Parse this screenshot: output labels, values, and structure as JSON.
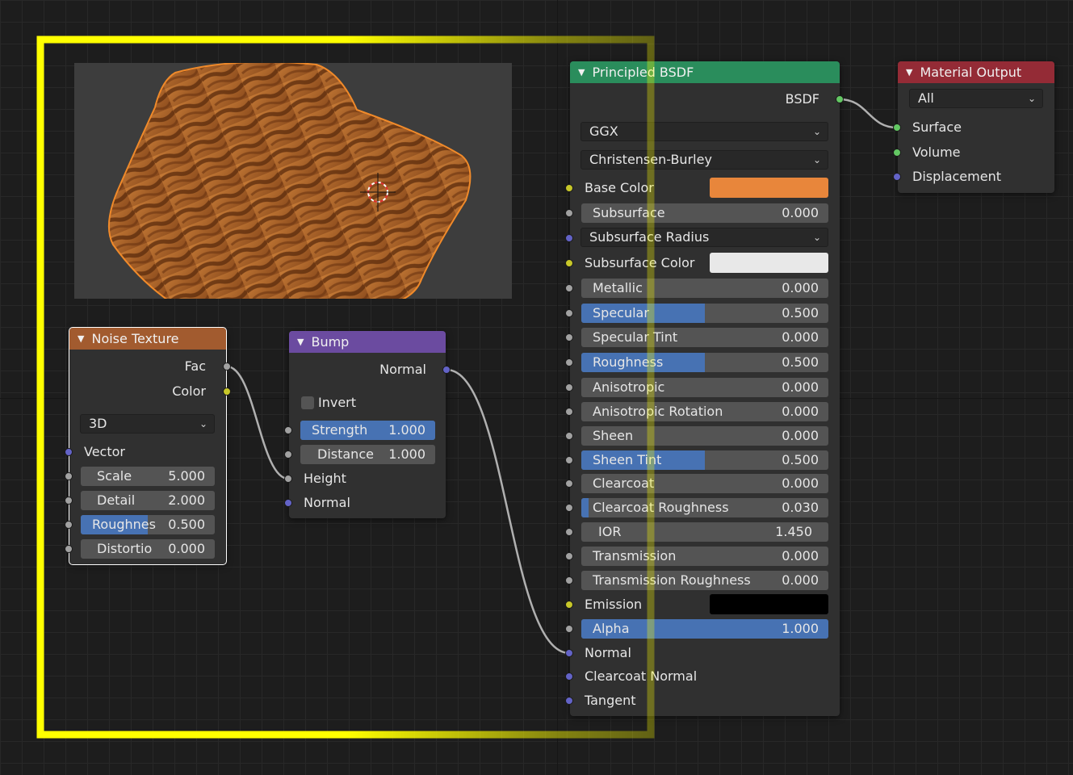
{
  "noise_texture": {
    "title": "Noise Texture",
    "outputs": [
      "Fac",
      "Color"
    ],
    "dimension": "3D",
    "vector_label": "Vector",
    "fields": [
      {
        "label": "Scale",
        "value": "5.000",
        "fill": 0
      },
      {
        "label": "Detail",
        "value": "2.000",
        "fill": 0
      },
      {
        "label": "Roughnes",
        "value": "0.500",
        "fill": 0.5
      },
      {
        "label": "Distortio",
        "value": "0.000",
        "fill": 0
      }
    ]
  },
  "bump": {
    "title": "Bump",
    "output": "Normal",
    "invert_label": "Invert",
    "invert_checked": false,
    "fields": [
      {
        "label": "Strength",
        "value": "1.000",
        "fill": 1
      },
      {
        "label": "Distance",
        "value": "1.000",
        "fill": 0
      }
    ],
    "inputs": [
      "Height",
      "Normal"
    ]
  },
  "principled_bsdf": {
    "title": "Principled BSDF",
    "output": "BSDF",
    "distribution": "GGX",
    "subsurface_method": "Christensen-Burley",
    "base_color_label": "Base Color",
    "base_color": "#e8863b",
    "subsurface_label": "Subsurface",
    "subsurface_value": "0.000",
    "subsurface_radius_label": "Subsurface Radius",
    "subsurface_color_label": "Subsurface Color",
    "subsurface_color": "#e8e8e8",
    "fields": [
      {
        "label": "Metallic",
        "value": "0.000",
        "fill": 0
      },
      {
        "label": "Specular",
        "value": "0.500",
        "fill": 0.5
      },
      {
        "label": "Specular Tint",
        "value": "0.000",
        "fill": 0
      },
      {
        "label": "Roughness",
        "value": "0.500",
        "fill": 0.5
      },
      {
        "label": "Anisotropic",
        "value": "0.000",
        "fill": 0
      },
      {
        "label": "Anisotropic Rotation",
        "value": "0.000",
        "fill": 0
      },
      {
        "label": "Sheen",
        "value": "0.000",
        "fill": 0
      },
      {
        "label": "Sheen Tint",
        "value": "0.500",
        "fill": 0.5
      },
      {
        "label": "Clearcoat",
        "value": "0.000",
        "fill": 0
      },
      {
        "label": "Clearcoat Roughness",
        "value": "0.030",
        "fill": 0.03
      },
      {
        "label": "IOR",
        "value": "1.450",
        "fill": 0
      },
      {
        "label": "Transmission",
        "value": "0.000",
        "fill": 0
      },
      {
        "label": "Transmission Roughness",
        "value": "0.000",
        "fill": 0
      }
    ],
    "emission_label": "Emission",
    "emission_color": "#000000",
    "alpha_label": "Alpha",
    "alpha_value": "1.000",
    "alpha_fill": 1,
    "vector_inputs": [
      "Normal",
      "Clearcoat Normal",
      "Tangent"
    ]
  },
  "material_output": {
    "title": "Material Output",
    "target": "All",
    "inputs": [
      "Surface",
      "Volume",
      "Displacement"
    ]
  },
  "colors": {
    "frame": "#ffff00",
    "field_fill": "#4772b3",
    "selection_outline": "#ffffff"
  }
}
